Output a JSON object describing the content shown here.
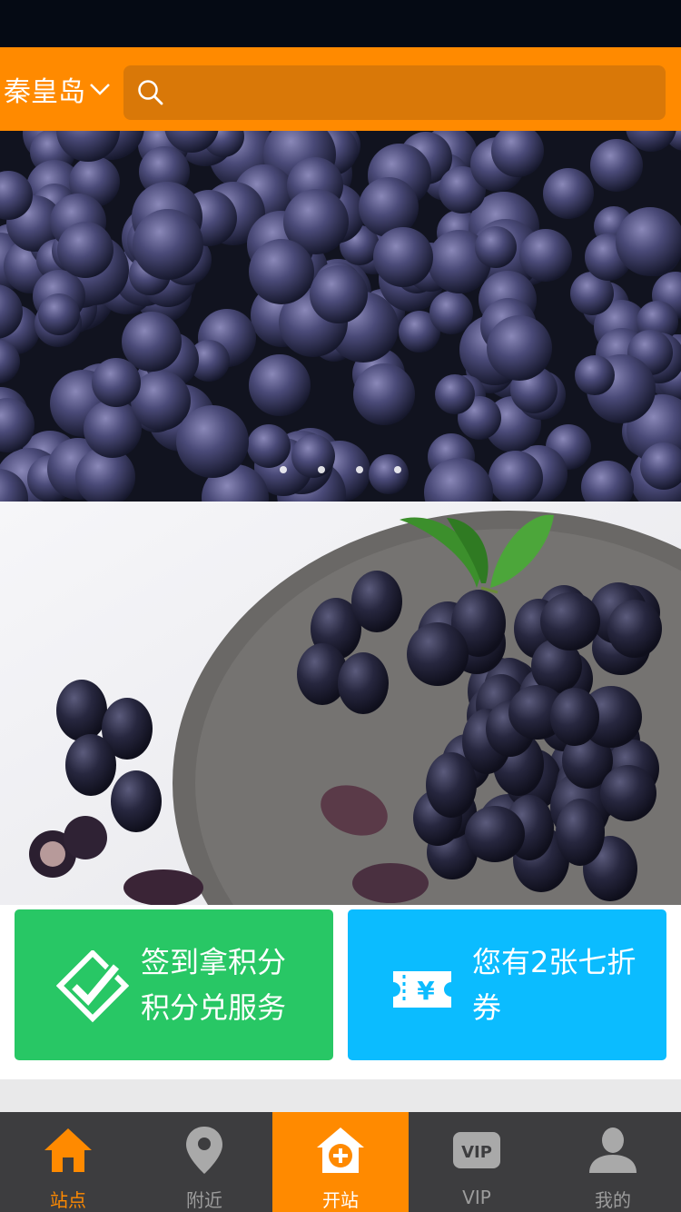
{
  "header": {
    "city": "秦皇岛",
    "search_placeholder": ""
  },
  "banner": {
    "slide_count": 4,
    "active_index": 0
  },
  "cards": {
    "signin": {
      "line1": "签到拿积分",
      "line2": "积分兑服务",
      "color": "#28c765"
    },
    "coupon": {
      "text": "您有2张七折券",
      "color": "#0bbcff"
    }
  },
  "tabs": [
    {
      "label": "站点",
      "icon": "home-icon",
      "active": true
    },
    {
      "label": "附近",
      "icon": "location-pin-icon",
      "active": false
    },
    {
      "label": "开站",
      "icon": "add-station-icon",
      "active": false
    },
    {
      "label": "VIP",
      "icon": "vip-badge-icon",
      "active": false
    },
    {
      "label": "我的",
      "icon": "user-icon",
      "active": false
    }
  ],
  "colors": {
    "accent": "#ff8a00",
    "tabbar": "#3d3d3f"
  }
}
